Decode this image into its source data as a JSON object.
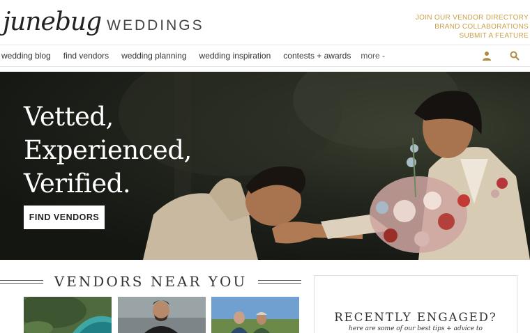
{
  "header": {
    "logo_script": "junebug",
    "logo_text": "WEDDINGS",
    "links": [
      "JOIN OUR VENDOR DIRECTORY",
      "BRAND COLLABORATIONS",
      "SUBMIT A FEATURE"
    ]
  },
  "nav": {
    "items": [
      "wedding blog",
      "find vendors",
      "wedding planning",
      "wedding inspiration",
      "contests + awards"
    ],
    "more": "more -",
    "icons": [
      "user-icon",
      "search-icon"
    ]
  },
  "hero": {
    "title_lines": [
      "Vetted,",
      "Experienced,",
      "Verified."
    ],
    "button": "FIND VENDORS"
  },
  "vendors": {
    "title": "VENDORS NEAR YOU"
  },
  "engaged": {
    "title": "RECENTLY ENGAGED?",
    "subtitle": "here are some of our best tips + advice to"
  },
  "colors": {
    "accent_gold": "#c9a14a",
    "hero_dark": "#1a1c17"
  }
}
